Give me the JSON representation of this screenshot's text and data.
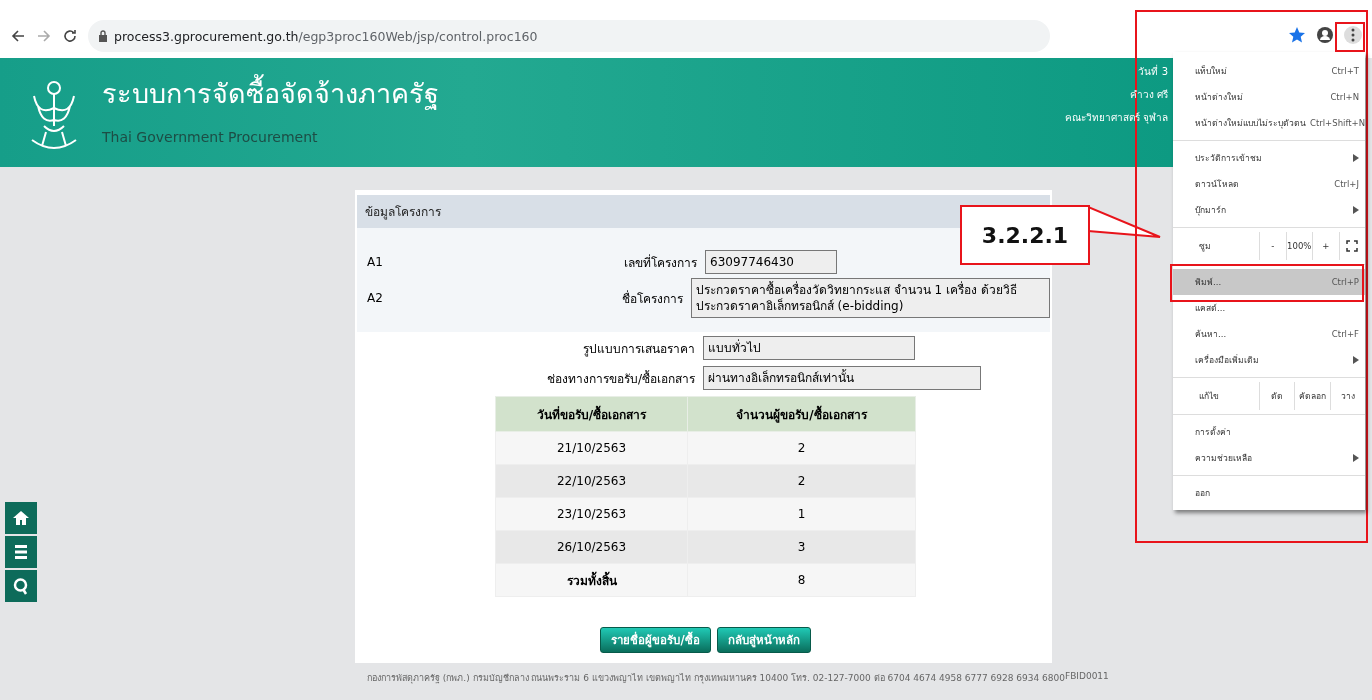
{
  "browser": {
    "url_host": "process3.gprocurement.go.th",
    "url_path": "/egp3proc160Web/jsp/control.proc160"
  },
  "header": {
    "title": "ระบบการจัดซื้อจัดจ้างภาครัฐ",
    "subtitle": "Thai Government Procurement",
    "user_info": [
      "วันที่ 3",
      "คำวง ศรี",
      "คณะวิทยาศาสตร์ จุฬาล"
    ]
  },
  "project": {
    "title": "ข้อมูลโครงการ",
    "fields": [
      {
        "code": "A1",
        "label": "เลขที่โครงการ",
        "value": "63097746430"
      },
      {
        "code": "A2",
        "label": "ชื่อโครงการ",
        "value": "ประกวดราคาซื้อเครื่องวัดวิทยากระแส จำนวน 1 เครื่อง ด้วยวิธีประกวดราคาอิเล็กทรอนิกส์ (e-bidding)"
      },
      {
        "label": "รูปแบบการเสนอราคา",
        "value": "แบบทั่วไป"
      },
      {
        "label": "ช่องทางการขอรับ/ซื้อเอกสาร",
        "value": "ผ่านทางอิเล็กทรอนิกส์เท่านั้น"
      }
    ],
    "table": {
      "columns": [
        "วันที่ขอรับ/ซื้อเอกสาร",
        "จำนวนผู้ขอรับ/ซื้อเอกสาร"
      ],
      "rows": [
        {
          "kind": "data",
          "cells": [
            "21/10/2563",
            "2"
          ]
        },
        {
          "kind": "data",
          "cells": [
            "22/10/2563",
            "2"
          ]
        },
        {
          "kind": "data",
          "cells": [
            "23/10/2563",
            "1"
          ]
        },
        {
          "kind": "data",
          "cells": [
            "26/10/2563",
            "3"
          ]
        },
        {
          "kind": "total",
          "cells": [
            "รวมทั้งสิ้น",
            "8"
          ]
        }
      ]
    },
    "buttons": [
      "รายชื่อผู้ขอรับ/ซื้อ",
      "กลับสู่หน้าหลัก"
    ]
  },
  "footer": {
    "text": "กองการพัสดุภาครัฐ (กพภ.) กรมบัญชีกลาง ถนนพระราม 6 แขวงพญาไท เขตพญาไท กรุงเทพมหานคร 10400 โทร. 02-127-7000 ต่อ 6704 4674 4958 6777 6928 6934 6800",
    "code": "FBID0011"
  },
  "menu": [
    {
      "kind": "item",
      "label": "แท็บใหม่",
      "shortcut": "Ctrl+T",
      "submenu": false,
      "selected": false
    },
    {
      "kind": "item",
      "label": "หน้าต่างใหม่",
      "shortcut": "Ctrl+N",
      "submenu": false,
      "selected": false
    },
    {
      "kind": "item",
      "label": "หน้าต่างใหม่แบบไม่ระบุตัวตน",
      "shortcut": "Ctrl+Shift+N",
      "submenu": false,
      "selected": false
    },
    {
      "kind": "divider"
    },
    {
      "kind": "item",
      "label": "ประวัติการเข้าชม",
      "submenu": true,
      "selected": false
    },
    {
      "kind": "item",
      "label": "ดาวน์โหลด",
      "shortcut": "Ctrl+J",
      "submenu": false,
      "selected": false
    },
    {
      "kind": "item",
      "label": "บุ๊กมาร์ก",
      "submenu": true,
      "selected": false
    },
    {
      "kind": "divider"
    },
    {
      "kind": "zoom",
      "label": "ซูม",
      "minus": "-",
      "value": "100%",
      "plus": "+"
    },
    {
      "kind": "divider"
    },
    {
      "kind": "item",
      "label": "พิมพ์...",
      "shortcut": "Ctrl+P",
      "submenu": false,
      "selected": true
    },
    {
      "kind": "item",
      "label": "แคสต์...",
      "submenu": false,
      "selected": false
    },
    {
      "kind": "item",
      "label": "ค้นหา...",
      "shortcut": "Ctrl+F",
      "submenu": false,
      "selected": false
    },
    {
      "kind": "item",
      "label": "เครื่องมือเพิ่มเติม",
      "submenu": true,
      "selected": false
    },
    {
      "kind": "divider"
    },
    {
      "kind": "edit",
      "label": "แก้ไข",
      "actions": [
        "ตัด",
        "คัดลอก",
        "วาง"
      ]
    },
    {
      "kind": "divider"
    },
    {
      "kind": "item",
      "label": "การตั้งค่า",
      "submenu": false,
      "selected": false
    },
    {
      "kind": "item",
      "label": "ความช่วยเหลือ",
      "submenu": true,
      "selected": false
    },
    {
      "kind": "divider"
    },
    {
      "kind": "item",
      "label": "ออก",
      "submenu": false,
      "selected": false
    }
  ],
  "annotation": {
    "label": "3.2.2.1"
  }
}
